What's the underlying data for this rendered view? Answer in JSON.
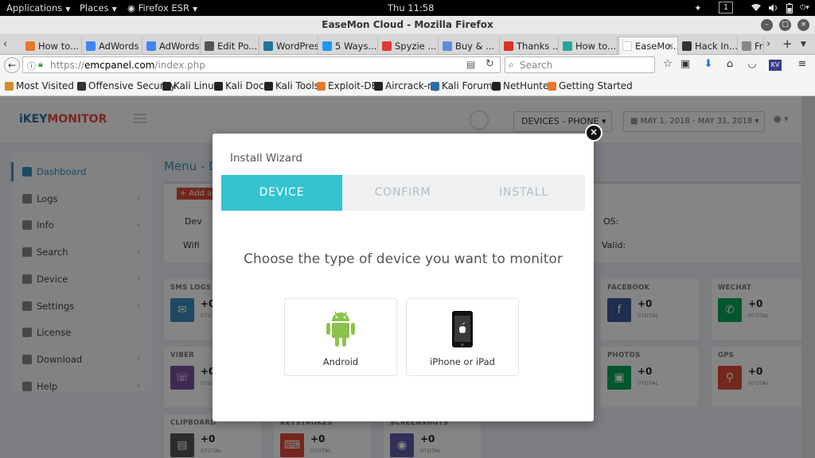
{
  "topbar": {
    "applications": "Applications",
    "places": "Places",
    "firefox": "Firefox ESR",
    "clock": "Thu 11:58",
    "workspace": "1"
  },
  "window": {
    "title": "EaseMon Cloud - Mozilla Firefox"
  },
  "tabs": [
    {
      "label": "How to...",
      "color": "#e8762b"
    },
    {
      "label": "AdWords",
      "color": "#4285f4"
    },
    {
      "label": "AdWords",
      "color": "#4285f4"
    },
    {
      "label": "Edit Po...",
      "color": "#555555"
    },
    {
      "label": "WordPress...",
      "color": "#21759b"
    },
    {
      "label": "5 Ways...",
      "color": "#2196f3"
    },
    {
      "label": "Spyzie ...",
      "color": "#e53935"
    },
    {
      "label": "Buy & ...",
      "color": "#5b8dd6"
    },
    {
      "label": "Thanks ...",
      "color": "#d93025"
    },
    {
      "label": "How to...",
      "color": "#26a69a"
    },
    {
      "label": "EaseMo...",
      "color": "#ffffff"
    },
    {
      "label": "Hack In...",
      "color": "#333333"
    },
    {
      "label": "Free",
      "color": "#888888"
    }
  ],
  "navbar": {
    "url_scheme": "https://",
    "url_host": "emcpanel.com",
    "url_path": "/index.php",
    "search_placeholder": "Search"
  },
  "bookmarks": [
    {
      "label": "Most Visited",
      "color": "#d98a2b"
    },
    {
      "label": "Offensive Security",
      "color": "#333333"
    },
    {
      "label": "Kali Linux",
      "color": "#222222"
    },
    {
      "label": "Kali Docs",
      "color": "#222222"
    },
    {
      "label": "Kali Tools",
      "color": "#222222"
    },
    {
      "label": "Exploit-DB",
      "color": "#e8762b"
    },
    {
      "label": "Aircrack-ng",
      "color": "#222222"
    },
    {
      "label": "Kali Forums",
      "color": "#2a6ea6"
    },
    {
      "label": "NetHunter",
      "color": "#222222"
    },
    {
      "label": "Getting Started",
      "color": "#e8762b"
    }
  ],
  "app": {
    "logo_left": "iKEY",
    "logo_right": "MONITOR",
    "device_select": "DEVICES - PHONE",
    "date_range": "MAY 1, 2018 - MAY 31, 2018",
    "menu_title": "Menu - D",
    "add_label": "+ Add a",
    "info": {
      "device": "Dev",
      "wifi": "Wifi",
      "os": "OS:",
      "valid": "Valid:"
    },
    "sidebar": [
      {
        "label": "Dashboard",
        "chev": ""
      },
      {
        "label": "Logs",
        "chev": "‹"
      },
      {
        "label": "Info",
        "chev": "‹"
      },
      {
        "label": "Search",
        "chev": "‹"
      },
      {
        "label": "Device",
        "chev": "‹"
      },
      {
        "label": "Settings",
        "chev": "‹"
      },
      {
        "label": "License",
        "chev": ""
      },
      {
        "label": "Download",
        "chev": "‹"
      },
      {
        "label": "Help",
        "chev": "‹"
      }
    ],
    "cards": [
      {
        "title": "SMS LOGS",
        "value": "+0",
        "sub": "0TOTAL",
        "color": "#3c8dbc",
        "glyph": "✉"
      },
      {
        "title": "FACEBOOK",
        "value": "+0",
        "sub": "0TOTAL",
        "color": "#3b5998",
        "glyph": "f"
      },
      {
        "title": "WECHAT",
        "value": "+0",
        "sub": "0TOTAL",
        "color": "#00a65a",
        "glyph": "✆"
      },
      {
        "title": "VIBER",
        "value": "+0",
        "sub": "0TOTAL",
        "color": "#7b519d",
        "glyph": "☏"
      },
      {
        "title": "PHOTOS",
        "value": "+0",
        "sub": "0TOTAL",
        "color": "#00a65a",
        "glyph": "▣"
      },
      {
        "title": "GPS",
        "value": "+0",
        "sub": "0TOTAL",
        "color": "#dd4b39",
        "glyph": "⚲"
      },
      {
        "title": "CLIPBOARD",
        "value": "+0",
        "sub": "0TOTAL",
        "color": "#555555",
        "glyph": "▤"
      },
      {
        "title": "KEYSTROKES",
        "value": "+0",
        "sub": "0TOTAL",
        "color": "#dd4b39",
        "glyph": "⌨"
      },
      {
        "title": "SCREENSHOTS",
        "value": "+0",
        "sub": "0TOTAL",
        "color": "#605ca8",
        "glyph": "◉"
      }
    ]
  },
  "modal": {
    "title": "Install Wizard",
    "close": "×",
    "steps": [
      "DEVICE",
      "CONFIRM",
      "INSTALL"
    ],
    "prompt": "Choose the type of device you want to monitor",
    "options": [
      {
        "label": "Android"
      },
      {
        "label": "iPhone or iPad"
      }
    ],
    "colors": {
      "accent": "#33c3cf",
      "android": "#8bc34a"
    }
  }
}
